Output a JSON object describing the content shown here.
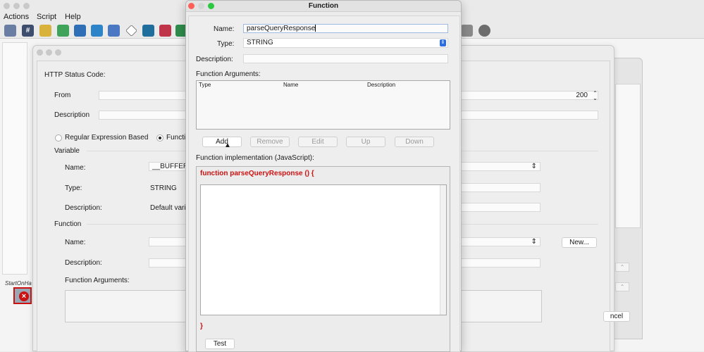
{
  "menubar": {
    "items": [
      "Actions",
      "Script",
      "Help"
    ]
  },
  "toolbar": {
    "icons": [
      "monitor-icon",
      "hash-script-icon",
      "pencil-icon",
      "check-pencil-icon",
      "cross-tools-icon",
      "shuffle-icon",
      "calculator-icon",
      "diamond-icon",
      "user-download-icon",
      "checklist-icon",
      "checklist-plus-icon"
    ],
    "right_icons": [
      "camera-icon",
      "gear-icon"
    ]
  },
  "canvas": {
    "node_label": "StartOnHa"
  },
  "status_dialog": {
    "heading": "HTTP Status Code:",
    "from_label": "From",
    "from_value": "200",
    "description_label": "Description",
    "radio_regex_label": "Regular Expression Based",
    "radio_function_label": "Functi",
    "variable_section": "Variable",
    "var_name_label": "Name:",
    "var_name_value": "__BUFFER_",
    "var_type_label": "Type:",
    "var_type_value": "STRING",
    "var_desc_label": "Description:",
    "var_desc_value": "Default vari",
    "function_section": "Function",
    "fn_name_label": "Name:",
    "fn_desc_label": "Description:",
    "fn_args_label": "Function Arguments:",
    "new_button": "New...",
    "cancel_button": "ncel"
  },
  "function_dialog": {
    "title": "Function",
    "name_label": "Name:",
    "name_value": "parseQueryResponse",
    "type_label": "Type:",
    "type_value": "STRING",
    "description_label": "Description:",
    "description_value": "",
    "args_label": "Function Arguments:",
    "args_columns": [
      "Type",
      "Name",
      "Description"
    ],
    "buttons": {
      "add": "Add",
      "remove": "Remove",
      "edit": "Edit",
      "up": "Up",
      "down": "Down"
    },
    "impl_label": "Function implementation (JavaScript):",
    "code_header": "function parseQueryResponse () {",
    "code_footer": "}",
    "test_button": "Test"
  },
  "colors": {
    "code_red": "#cc1111",
    "background": "#ececec"
  }
}
